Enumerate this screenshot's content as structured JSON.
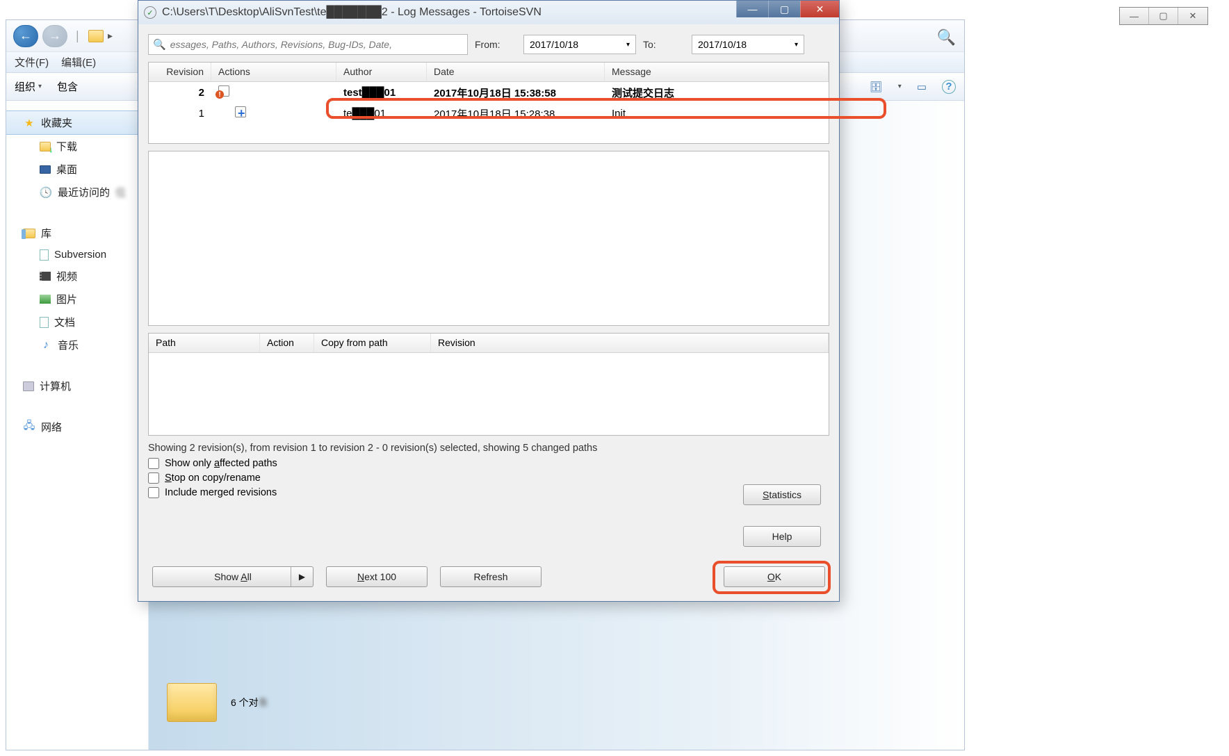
{
  "bg_window_controls": {
    "min": "—",
    "max": "▢",
    "close": "✕"
  },
  "explorer": {
    "menu": [
      "文件(F)",
      "编辑(E)"
    ],
    "toolbar": {
      "organize": "组织",
      "include": "包含"
    },
    "right_tools": {
      "view_icon": "≡",
      "pane_icon": "▭",
      "help_icon": "?"
    },
    "sidebar": {
      "favorites": "收藏夹",
      "downloads": "下载",
      "desktop": "桌面",
      "recent": "最近访问的",
      "library": "库",
      "subversion": "Subversion",
      "video": "视频",
      "pictures": "图片",
      "documents": "文档",
      "music": "音乐",
      "computer": "计算机",
      "network": "网络"
    },
    "content_label": "6 个对"
  },
  "dialog": {
    "title": "C:\\Users\\T\\Desktop\\AliSvnTest\\te███████2 - Log Messages - TortoiseSVN",
    "search_placeholder": "essages, Paths, Authors, Revisions, Bug-IDs, Date,",
    "from_label": "From:",
    "to_label": "To:",
    "from_date": "2017/10/18",
    "to_date": "2017/10/18",
    "columns": {
      "rev": "Revision",
      "act": "Actions",
      "auth": "Author",
      "date": "Date",
      "msg": "Message"
    },
    "rows": [
      {
        "rev": "2",
        "author": "test███01",
        "date": "2017年10月18日 15:38:58",
        "msg": "测试提交日志",
        "bold": true,
        "icon": "modified"
      },
      {
        "rev": "1",
        "author": "te███01",
        "date": "2017年10月18日 15:28:38",
        "msg": "Init",
        "bold": false,
        "icon": "added"
      }
    ],
    "file_columns": {
      "path": "Path",
      "action": "Action",
      "copy": "Copy from path",
      "rev": "Revision"
    },
    "status": "Showing 2 revision(s), from revision 1 to revision 2 - 0 revision(s) selected, showing 5 changed paths",
    "chk_affected": "Show only affected paths",
    "chk_stop": "Stop on copy/rename",
    "chk_merged": "Include merged revisions",
    "btn_stats": "Statistics",
    "btn_help": "Help",
    "btn_showall": "Show All",
    "btn_next": "Next 100",
    "btn_refresh": "Refresh",
    "btn_ok": "OK"
  }
}
